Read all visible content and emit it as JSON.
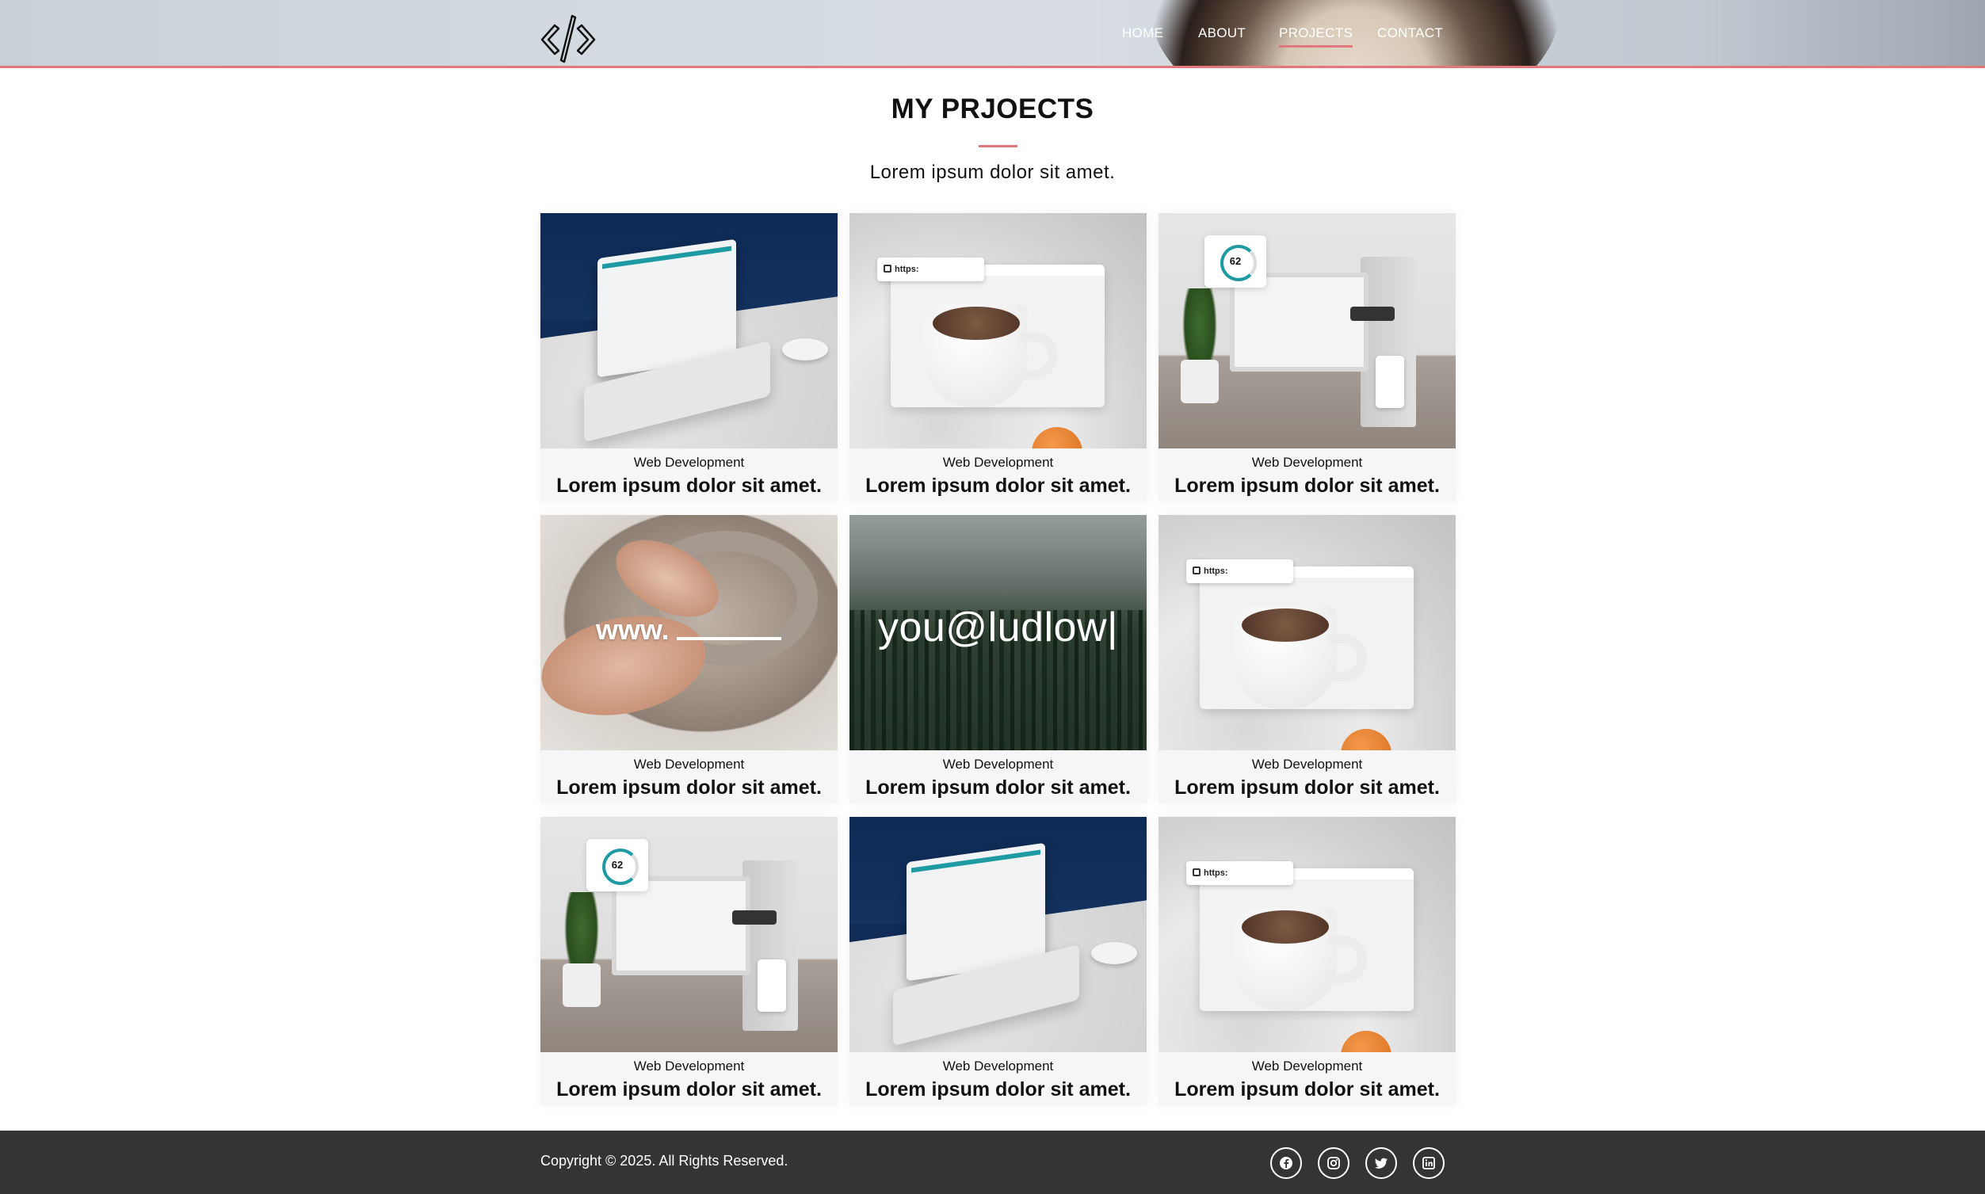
{
  "header": {
    "logo_alt": "code-logo",
    "nav": [
      {
        "label": "HOME",
        "active": false
      },
      {
        "label": "ABOUT",
        "active": false
      },
      {
        "label": "PROJECTS",
        "active": true
      },
      {
        "label": "CONTACT",
        "active": false
      }
    ],
    "accent_color": "#e2787c"
  },
  "section": {
    "title": "MY PRJOECTS",
    "subtitle": "Lorem ipsum dolor sit amet."
  },
  "projects": [
    {
      "image": "laptop-dashboard",
      "category": "Web Development",
      "title": "Lorem ipsum dolor sit amet."
    },
    {
      "image": "coffee-https-browser",
      "category": "Web Development",
      "title": "Lorem ipsum dolor sit amet.",
      "overlay_text": "https:"
    },
    {
      "image": "desk-performance-62",
      "category": "Web Development",
      "title": "Lorem ipsum dolor sit amet.",
      "overlay_text": "62"
    },
    {
      "image": "pottery-www",
      "category": "Web Development",
      "title": "Lorem ipsum dolor sit amet.",
      "overlay_text": "www."
    },
    {
      "image": "forest-email",
      "category": "Web Development",
      "title": "Lorem ipsum dolor sit amet.",
      "overlay_text": "you@ludlow|"
    },
    {
      "image": "coffee-https-browser",
      "category": "Web Development",
      "title": "Lorem ipsum dolor sit amet.",
      "overlay_text": "https:"
    },
    {
      "image": "desk-performance-62",
      "category": "Web Development",
      "title": "Lorem ipsum dolor sit amet.",
      "overlay_text": "62"
    },
    {
      "image": "laptop-dashboard",
      "category": "Web Development",
      "title": "Lorem ipsum dolor sit amet."
    },
    {
      "image": "coffee-https-browser",
      "category": "Web Development",
      "title": "Lorem ipsum dolor sit amet.",
      "overlay_text": "https:"
    }
  ],
  "footer": {
    "copyright": "Copyright © 2025. All Rights Reserved.",
    "social": [
      "facebook-icon",
      "instagram-icon",
      "twitter-icon",
      "linkedin-icon"
    ],
    "background": "#343434"
  }
}
